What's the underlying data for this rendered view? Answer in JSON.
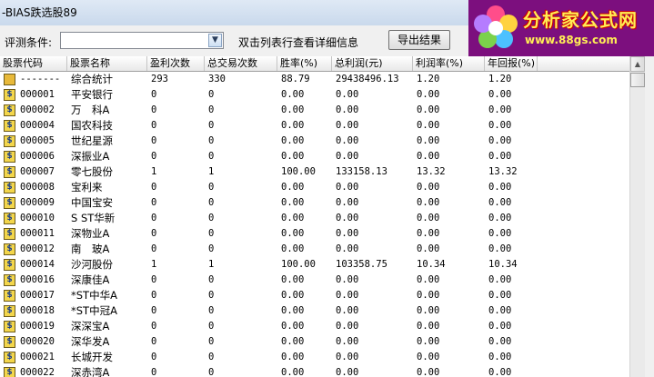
{
  "window": {
    "title": "-BIAS跌选股89"
  },
  "logo": {
    "text": "分析家公式网",
    "url": "www.88gs.com"
  },
  "filter": {
    "label": "评测条件:",
    "value": "",
    "hint": "双击列表行查看详细信息",
    "export_label": "导出结果"
  },
  "table": {
    "columns": [
      "股票代码",
      "股票名称",
      "盈利次数",
      "总交易次数",
      "胜率(%)",
      "总利润(元)",
      "利润率(%)",
      "年回报(%)"
    ],
    "rows": [
      {
        "code": "-------",
        "name": "综合统计",
        "wins": "293",
        "trades": "330",
        "win_rate": "88.79",
        "profit": "29438496.13",
        "profit_rate": "1.20",
        "annual": "1.20",
        "icon": "total"
      },
      {
        "code": "000001",
        "name": "平安银行",
        "wins": "0",
        "trades": "0",
        "win_rate": "0.00",
        "profit": "0.00",
        "profit_rate": "0.00",
        "annual": "0.00",
        "icon": "stock"
      },
      {
        "code": "000002",
        "name": "万　科A",
        "wins": "0",
        "trades": "0",
        "win_rate": "0.00",
        "profit": "0.00",
        "profit_rate": "0.00",
        "annual": "0.00",
        "icon": "stock"
      },
      {
        "code": "000004",
        "name": "国农科技",
        "wins": "0",
        "trades": "0",
        "win_rate": "0.00",
        "profit": "0.00",
        "profit_rate": "0.00",
        "annual": "0.00",
        "icon": "stock"
      },
      {
        "code": "000005",
        "name": "世纪星源",
        "wins": "0",
        "trades": "0",
        "win_rate": "0.00",
        "profit": "0.00",
        "profit_rate": "0.00",
        "annual": "0.00",
        "icon": "stock"
      },
      {
        "code": "000006",
        "name": "深振业A",
        "wins": "0",
        "trades": "0",
        "win_rate": "0.00",
        "profit": "0.00",
        "profit_rate": "0.00",
        "annual": "0.00",
        "icon": "stock"
      },
      {
        "code": "000007",
        "name": "零七股份",
        "wins": "1",
        "trades": "1",
        "win_rate": "100.00",
        "profit": "133158.13",
        "profit_rate": "13.32",
        "annual": "13.32",
        "icon": "stock"
      },
      {
        "code": "000008",
        "name": "宝利来",
        "wins": "0",
        "trades": "0",
        "win_rate": "0.00",
        "profit": "0.00",
        "profit_rate": "0.00",
        "annual": "0.00",
        "icon": "stock"
      },
      {
        "code": "000009",
        "name": "中国宝安",
        "wins": "0",
        "trades": "0",
        "win_rate": "0.00",
        "profit": "0.00",
        "profit_rate": "0.00",
        "annual": "0.00",
        "icon": "stock"
      },
      {
        "code": "000010",
        "name": "S ST华新",
        "wins": "0",
        "trades": "0",
        "win_rate": "0.00",
        "profit": "0.00",
        "profit_rate": "0.00",
        "annual": "0.00",
        "icon": "stock"
      },
      {
        "code": "000011",
        "name": "深物业A",
        "wins": "0",
        "trades": "0",
        "win_rate": "0.00",
        "profit": "0.00",
        "profit_rate": "0.00",
        "annual": "0.00",
        "icon": "stock"
      },
      {
        "code": "000012",
        "name": "南　玻A",
        "wins": "0",
        "trades": "0",
        "win_rate": "0.00",
        "profit": "0.00",
        "profit_rate": "0.00",
        "annual": "0.00",
        "icon": "stock"
      },
      {
        "code": "000014",
        "name": "沙河股份",
        "wins": "1",
        "trades": "1",
        "win_rate": "100.00",
        "profit": "103358.75",
        "profit_rate": "10.34",
        "annual": "10.34",
        "icon": "stock"
      },
      {
        "code": "000016",
        "name": "深康佳A",
        "wins": "0",
        "trades": "0",
        "win_rate": "0.00",
        "profit": "0.00",
        "profit_rate": "0.00",
        "annual": "0.00",
        "icon": "stock"
      },
      {
        "code": "000017",
        "name": "*ST中华A",
        "wins": "0",
        "trades": "0",
        "win_rate": "0.00",
        "profit": "0.00",
        "profit_rate": "0.00",
        "annual": "0.00",
        "icon": "stock"
      },
      {
        "code": "000018",
        "name": "*ST中冠A",
        "wins": "0",
        "trades": "0",
        "win_rate": "0.00",
        "profit": "0.00",
        "profit_rate": "0.00",
        "annual": "0.00",
        "icon": "stock"
      },
      {
        "code": "000019",
        "name": "深深宝A",
        "wins": "0",
        "trades": "0",
        "win_rate": "0.00",
        "profit": "0.00",
        "profit_rate": "0.00",
        "annual": "0.00",
        "icon": "stock"
      },
      {
        "code": "000020",
        "name": "深华发A",
        "wins": "0",
        "trades": "0",
        "win_rate": "0.00",
        "profit": "0.00",
        "profit_rate": "0.00",
        "annual": "0.00",
        "icon": "stock"
      },
      {
        "code": "000021",
        "name": "长城开发",
        "wins": "0",
        "trades": "0",
        "win_rate": "0.00",
        "profit": "0.00",
        "profit_rate": "0.00",
        "annual": "0.00",
        "icon": "stock"
      },
      {
        "code": "000022",
        "name": "深赤湾A",
        "wins": "0",
        "trades": "0",
        "win_rate": "0.00",
        "profit": "0.00",
        "profit_rate": "0.00",
        "annual": "0.00",
        "icon": "stock"
      }
    ]
  }
}
